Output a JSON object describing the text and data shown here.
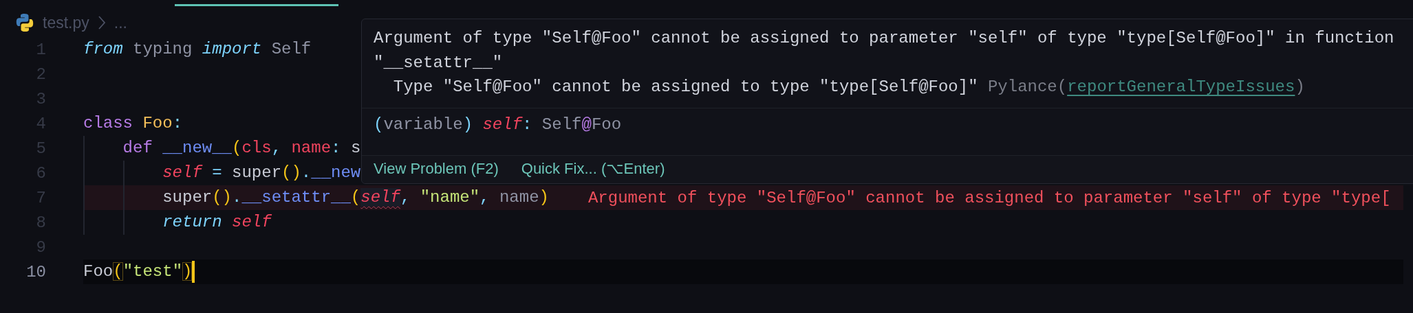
{
  "breadcrumb": {
    "file": "test.py",
    "more": "..."
  },
  "lines": [
    {
      "number": "1",
      "current": false,
      "tokens": [
        {
          "text": "from",
          "kind": "keyword"
        },
        {
          "text": " typing ",
          "kind": "dim"
        },
        {
          "text": "import",
          "kind": "keyword"
        },
        {
          "text": " Self",
          "kind": "dim"
        }
      ]
    },
    {
      "number": "2",
      "current": false
    },
    {
      "number": "3",
      "current": false
    },
    {
      "number": "4",
      "current": false,
      "tokens": [
        {
          "text": "class ",
          "kind": "storage"
        },
        {
          "text": "Foo",
          "kind": "classname"
        },
        {
          "text": ":",
          "kind": "punct"
        }
      ],
      "children": [
        {
          "number": "5",
          "current": false,
          "tokens": [
            {
              "text": "def ",
              "kind": "storage"
            },
            {
              "text": "__new__",
              "kind": "func"
            },
            {
              "text": "(",
              "kind": "bracket"
            },
            {
              "text": "cls",
              "kind": "param"
            },
            {
              "text": ", ",
              "kind": "punct"
            },
            {
              "text": "name",
              "kind": "param"
            },
            {
              "text": ": ",
              "kind": "punct"
            },
            {
              "text": "s",
              "kind": "plain"
            }
          ],
          "children": [
            {
              "number": "6",
              "current": false,
              "tokens": [
                {
                  "text": "self",
                  "kind": "self"
                },
                {
                  "text": " = ",
                  "kind": "op"
                },
                {
                  "text": "super",
                  "kind": "plain"
                },
                {
                  "text": "()",
                  "kind": "bracket"
                },
                {
                  "text": ".",
                  "kind": "punct"
                },
                {
                  "text": "__new",
                  "kind": "func"
                }
              ]
            },
            {
              "number": "7",
              "current": false,
              "diagnostic": "Argument of type \"Self@Foo\" cannot be assigned to parameter \"self\" of type \"type[",
              "tokens": [
                {
                  "text": "super",
                  "kind": "plain"
                },
                {
                  "text": "()",
                  "kind": "bracket"
                },
                {
                  "text": ".",
                  "kind": "punct"
                },
                {
                  "text": "__setattr__",
                  "kind": "func"
                },
                {
                  "text": "(",
                  "kind": "bracket"
                },
                {
                  "text": "self",
                  "kind": "self-error"
                },
                {
                  "text": ", ",
                  "kind": "punct"
                },
                {
                  "text": "\"name\"",
                  "kind": "string"
                },
                {
                  "text": ", ",
                  "kind": "punct"
                },
                {
                  "text": "name",
                  "kind": "dim"
                },
                {
                  "text": ")",
                  "kind": "bracket"
                }
              ]
            },
            {
              "number": "8",
              "current": false,
              "tokens": [
                {
                  "text": "return ",
                  "kind": "keyword"
                },
                {
                  "text": "self",
                  "kind": "self"
                }
              ]
            }
          ]
        }
      ]
    },
    {
      "number": "9",
      "current": false
    },
    {
      "number": "10",
      "current": true,
      "tokens": [
        {
          "text": "Foo",
          "kind": "plain"
        },
        {
          "text": "(",
          "kind": "bracket-matched"
        },
        {
          "text": "\"test\"",
          "kind": "string"
        },
        {
          "text": ")",
          "kind": "bracket-matched"
        }
      ]
    }
  ],
  "hover": {
    "message": "Argument of type \"Self@Foo\" cannot be assigned to parameter \"self\" of type \"type[Self@Foo]\" in function \"__setattr__\"",
    "detail": "  Type \"Self@Foo\" cannot be assigned to type \"type[Self@Foo]\"",
    "source": "Pylance(",
    "rule": "reportGeneralTypeIssues",
    "source_end": ")",
    "signature": [
      {
        "text": "(",
        "kind": "punct"
      },
      {
        "text": "variable",
        "kind": "dim"
      },
      {
        "text": ") ",
        "kind": "punct"
      },
      {
        "text": "self",
        "kind": "self"
      },
      {
        "text": ": ",
        "kind": "punct"
      },
      {
        "text": "Self",
        "kind": "dim"
      },
      {
        "text": "@",
        "kind": "storage"
      },
      {
        "text": "Foo",
        "kind": "dim"
      }
    ],
    "actions": [
      "View Problem (F2)",
      "Quick Fix... (⌥Enter)"
    ]
  }
}
